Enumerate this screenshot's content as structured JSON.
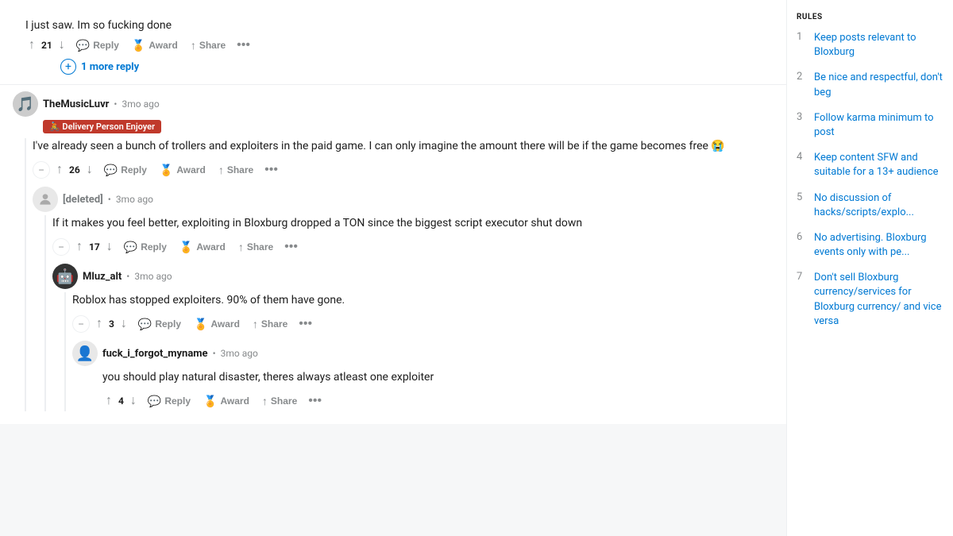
{
  "topComment": {
    "partialText": "I just saw. Im so fucking done",
    "votes": 21,
    "actions": {
      "reply": "Reply",
      "award": "Award",
      "share": "Share"
    },
    "moreReply": "1 more reply"
  },
  "mainComment": {
    "username": "TheMusicLuvr",
    "flair": "🚴 Delivery Person Enjoyer",
    "timestamp": "3mo ago",
    "body": "I've already seen a bunch of trollers and exploiters in the paid game. I can only imagine the amount there will be if the game becomes free 😭",
    "votes": 26,
    "actions": {
      "reply": "Reply",
      "award": "Award",
      "share": "Share"
    }
  },
  "reply1": {
    "username": "[deleted]",
    "timestamp": "3mo ago",
    "body": "If it makes you feel better, exploiting in Bloxburg dropped a TON since the biggest script executor shut down",
    "votes": 17,
    "actions": {
      "reply": "Reply",
      "award": "Award",
      "share": "Share"
    }
  },
  "reply2": {
    "username": "Mluz_alt",
    "timestamp": "3mo ago",
    "body": "Roblox has stopped exploiters. 90% of them have gone.",
    "votes": 3,
    "actions": {
      "reply": "Reply",
      "award": "Award",
      "share": "Share"
    }
  },
  "reply3": {
    "username": "fuck_i_forgot_myname",
    "timestamp": "3mo ago",
    "body": "you should play natural disaster, theres always atleast one exploiter",
    "votes": 4,
    "actions": {
      "reply": "Reply",
      "award": "Award",
      "share": "Share"
    }
  },
  "sidebar": {
    "title": "RULES",
    "rules": [
      {
        "number": 1,
        "text": "Keep posts relevant to Bloxburg"
      },
      {
        "number": 2,
        "text": "Be nice and respectful, don't beg"
      },
      {
        "number": 3,
        "text": "Follow karma minimum to post"
      },
      {
        "number": 4,
        "text": "Keep content SFW and suitable for a 13+ audience"
      },
      {
        "number": 5,
        "text": "No discussion of hacks/scripts/explo..."
      },
      {
        "number": 6,
        "text": "No advertising. Bloxburg events only with pe..."
      },
      {
        "number": 7,
        "text": "Don't sell Bloxburg currency/services for Bloxburg currency/ and vice versa"
      }
    ]
  }
}
